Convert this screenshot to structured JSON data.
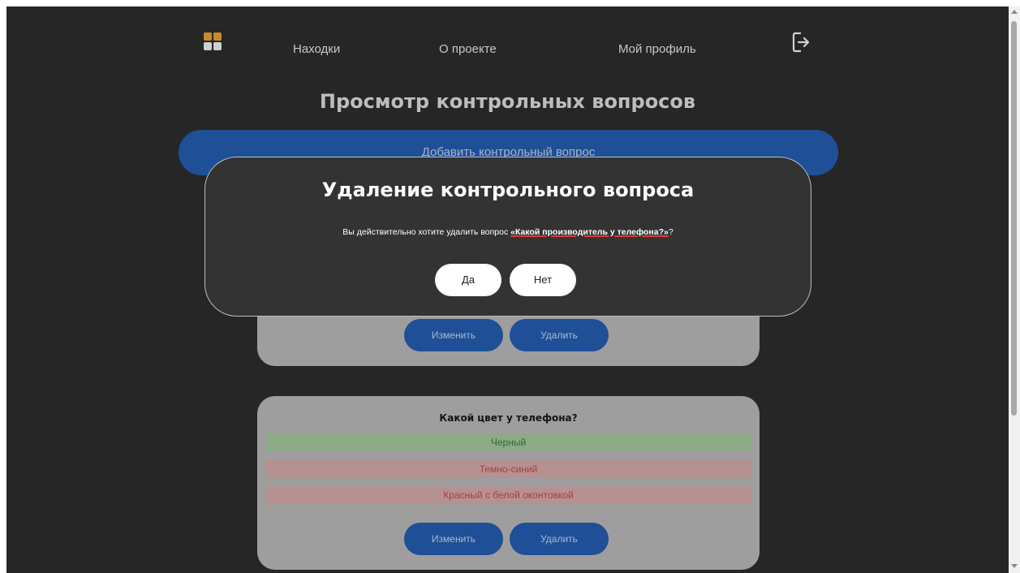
{
  "nav": {
    "links": [
      "Находки",
      "О проекте",
      "Мой профиль"
    ]
  },
  "page": {
    "title": "Просмотр контрольных вопросов",
    "add_button": "Добавить контрольный вопрос"
  },
  "cards": [
    {
      "question": "",
      "edit_label": "Изменить",
      "delete_label": "Удалить"
    },
    {
      "question": "Какой цвет у телефона?",
      "answers": [
        {
          "text": "Черный",
          "correct": true
        },
        {
          "text": "Темно-синий",
          "correct": false
        },
        {
          "text": "Красный с белой оконтовкой",
          "correct": false
        }
      ],
      "edit_label": "Изменить",
      "delete_label": "Удалить"
    }
  ],
  "modal": {
    "title": "Удаление контрольного вопроса",
    "text_before": "Вы действительно хотите удалить вопрос ",
    "question_name": "«Какой производитель у телефона?»",
    "text_after": "?",
    "yes_label": "Да",
    "no_label": "Нет"
  },
  "colors": {
    "background": "#262626",
    "primary_button": "#1f4f96",
    "modal_bg": "#333333",
    "logo_accent": "#c98a2c"
  }
}
